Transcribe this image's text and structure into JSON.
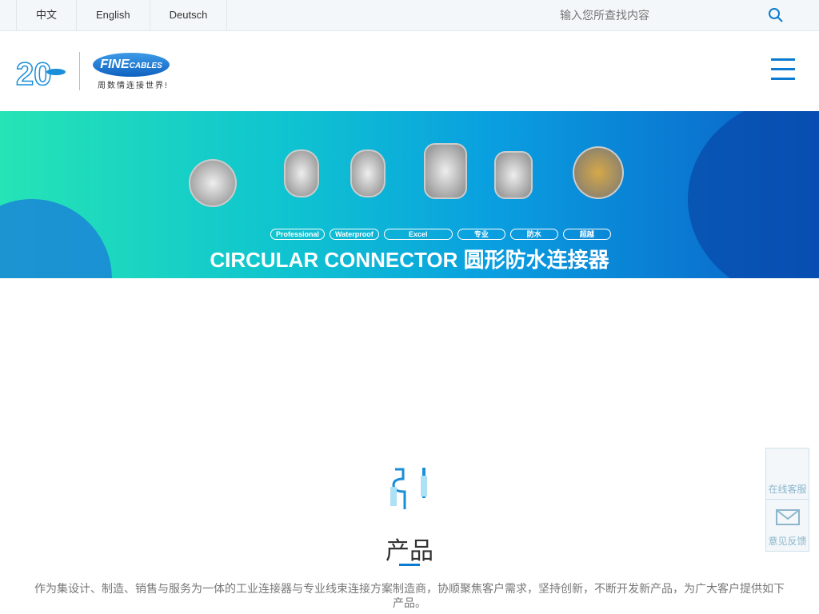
{
  "topbar": {
    "languages": [
      "中文",
      "English",
      "Deutsch"
    ],
    "search_placeholder": "输入您所查找内容"
  },
  "header": {
    "logo_20": "20",
    "logo_brand": "FINECABLES",
    "slogan": "周数情连接世界!"
  },
  "banner": {
    "tags": [
      "Professional",
      "Waterproof",
      "Excel",
      "专业",
      "防水",
      "超越"
    ],
    "title": "CIRCULAR CONNECTOR 圆形防水连接器"
  },
  "section": {
    "title": "产品",
    "description": "作为集设计、制造、销售与服务为一体的工业连接器与专业线束连接方案制造商，协顺聚焦客户需求，坚持创新，不断开发新产品，为广大客户提供如下产品。"
  },
  "side": {
    "online": "在线客服",
    "feedback": "意见反馈"
  },
  "colors": {
    "accent": "#0a7bd0"
  }
}
